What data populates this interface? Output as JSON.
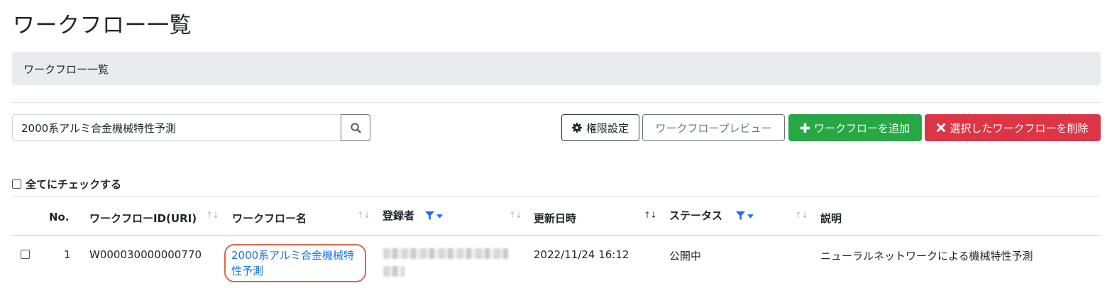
{
  "page": {
    "title": "ワークフロー一覧"
  },
  "breadcrumb": {
    "current": "ワークフロー一覧"
  },
  "search": {
    "value": "2000系アルミ合金機械特性予測",
    "icon": "search-icon"
  },
  "toolbar": {
    "permission_label": "権限設定",
    "preview_label": "ワークフロープレビュー",
    "add_label": "ワークフローを追加",
    "delete_label": "選択したワークフローを削除",
    "colors": {
      "add": "#28a745",
      "delete": "#dc3545",
      "link": "#1a73e8",
      "filter": "#1a73e8"
    }
  },
  "check_all": {
    "label": "全てにチェックする"
  },
  "table": {
    "columns": {
      "no": "No.",
      "id": "ワークフローID(URI)",
      "name": "ワークフロー名",
      "registrant": "登録者",
      "updated": "更新日時",
      "status": "ステータス",
      "description": "説明"
    },
    "sort_icon": "↑↓",
    "rows": [
      {
        "no": "1",
        "id": "W000030000000770",
        "name": "2000系アルミ合金機械特性予測",
        "updated": "2022/11/24 16:12",
        "status": "公開中",
        "description": "ニューラルネットワークによる機械特性予測"
      }
    ]
  }
}
